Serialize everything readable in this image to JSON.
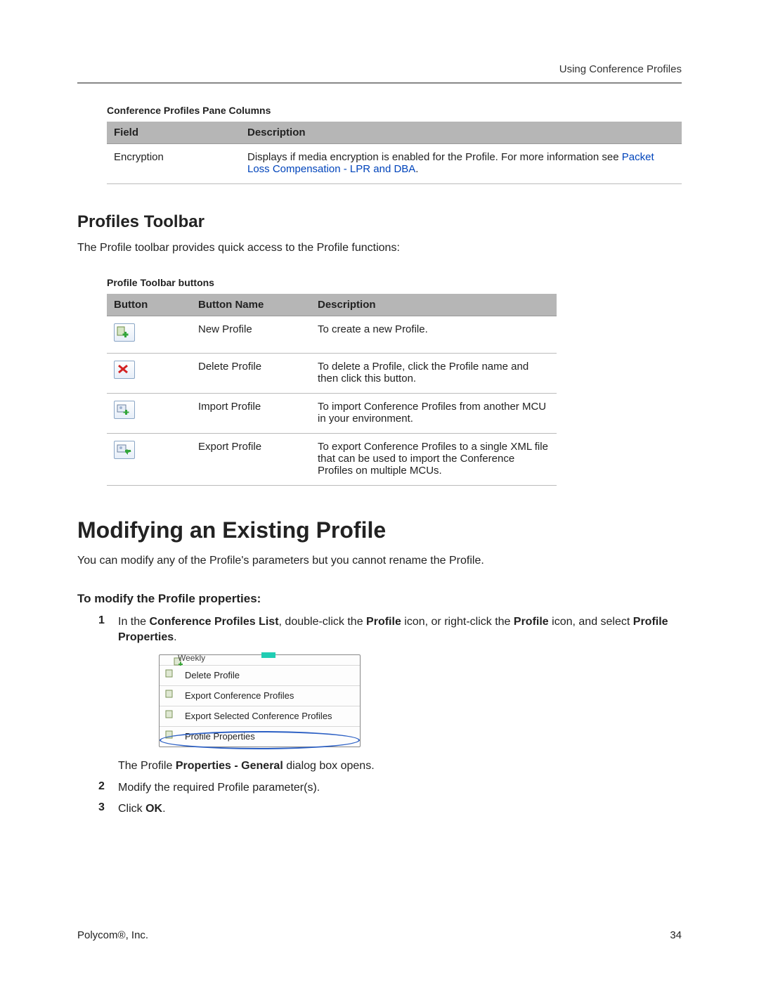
{
  "header": {
    "section": "Using Conference Profiles"
  },
  "table1": {
    "caption": "Conference Profiles Pane Columns",
    "columns": [
      "Field",
      "Description"
    ],
    "rows": [
      {
        "field": "Encryption",
        "desc_pre": "Displays if media encryption is enabled for the Profile. For more information see ",
        "link": "Packet Loss Compensation - LPR and DBA",
        "desc_post": "."
      }
    ]
  },
  "profiles_toolbar": {
    "heading": "Profiles Toolbar",
    "intro": "The Profile toolbar provides quick access to the Profile functions:",
    "table_caption": "Profile Toolbar buttons",
    "columns": [
      "Button",
      "Button Name",
      "Description"
    ],
    "rows": [
      {
        "name": "New Profile",
        "desc": "To create a new Profile."
      },
      {
        "name": "Delete Profile",
        "desc": "To delete a Profile, click the Profile name and then click this button."
      },
      {
        "name": "Import Profile",
        "desc": "To import Conference Profiles from another MCU in your environment."
      },
      {
        "name": "Export Profile",
        "desc": "To export Conference Profiles to a single XML file that can be used to import the Conference Profiles on multiple MCUs."
      }
    ]
  },
  "modify": {
    "h1": "Modifying an Existing Profile",
    "intro": "You can modify any of the Profile's parameters but you cannot rename the Profile.",
    "h3": "To modify the Profile properties:",
    "step1": {
      "pre": "In the ",
      "b1": "Conference Profiles List",
      "mid1": ", double-click the ",
      "b2": "Profile",
      "mid2": " icon, or right-click the ",
      "b3": "Profile",
      "mid3": " icon, and select ",
      "b4": "Profile Properties",
      "post": "."
    },
    "step1b": {
      "pre": "The Profile ",
      "b": "Properties - General",
      "post": " dialog box opens."
    },
    "step2": "Modify the required Profile parameter(s).",
    "step3_pre": "Click ",
    "step3_bold": "OK",
    "step3_post": "."
  },
  "context_menu": {
    "title_trunc": "Weekly",
    "items": [
      "Delete Profile",
      "Export Conference Profiles",
      "Export Selected Conference Profiles",
      "Profile Properties"
    ]
  },
  "footer": {
    "left": "Polycom®, Inc.",
    "right": "34"
  }
}
